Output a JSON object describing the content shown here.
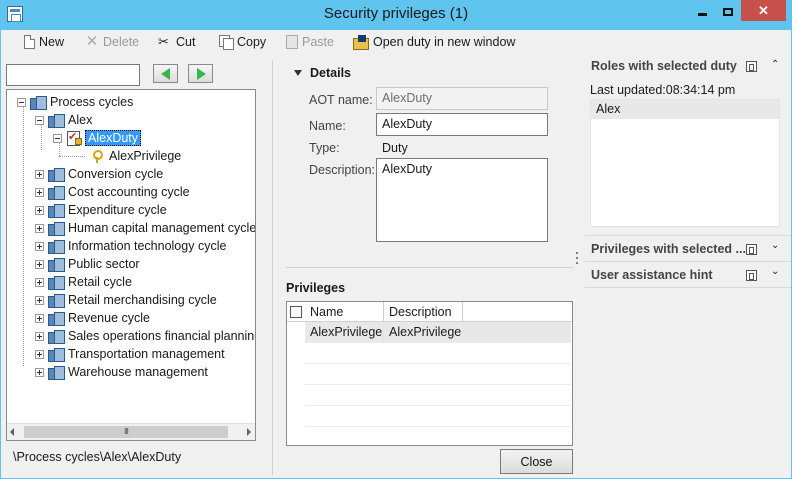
{
  "window": {
    "title": "Security privileges (1)",
    "close_glyph": "✕"
  },
  "toolbar": {
    "new_label": "New",
    "delete_label": "Delete",
    "cut_label": "Cut",
    "copy_label": "Copy",
    "paste_label": "Paste",
    "open_duty_label": "Open duty  in new window"
  },
  "search": {
    "value": ""
  },
  "tree": {
    "root": "Process cycles",
    "alex": "Alex",
    "duty": "AlexDuty",
    "privilege": "AlexPrivilege",
    "cycles": [
      "Conversion cycle",
      "Cost accounting cycle",
      "Expenditure cycle",
      "Human capital management cycle",
      "Information technology cycle",
      "Public sector",
      "Retail cycle",
      "Retail merchandising cycle",
      "Revenue cycle",
      "Sales operations financial planning",
      "Transportation management",
      "Warehouse management"
    ],
    "scroll_thumb": "III"
  },
  "status": {
    "path": "\\Process cycles\\Alex\\AlexDuty"
  },
  "details": {
    "heading": "Details",
    "aot_name_label": "AOT name:",
    "aot_name_value": "AlexDuty",
    "name_label": "Name:",
    "name_value": "AlexDuty",
    "type_label": "Type:",
    "type_value": "Duty",
    "description_label": "Description:",
    "description_value": "AlexDuty"
  },
  "privileges": {
    "heading": "Privileges",
    "columns": [
      "Name",
      "Description"
    ],
    "rows": [
      {
        "name": "AlexPrivilege",
        "description": "AlexPrivilege"
      }
    ]
  },
  "buttons": {
    "close_label": "Close"
  },
  "right_panel": {
    "roles_heading": "Roles with selected duty",
    "last_updated": "Last updated:08:34:14 pm",
    "roles": [
      "Alex"
    ],
    "privileges_heading": "Privileges with selected ...",
    "assistance_heading": "User assistance hint",
    "chevron_up": "⌃",
    "chevron_down": "⌄"
  }
}
